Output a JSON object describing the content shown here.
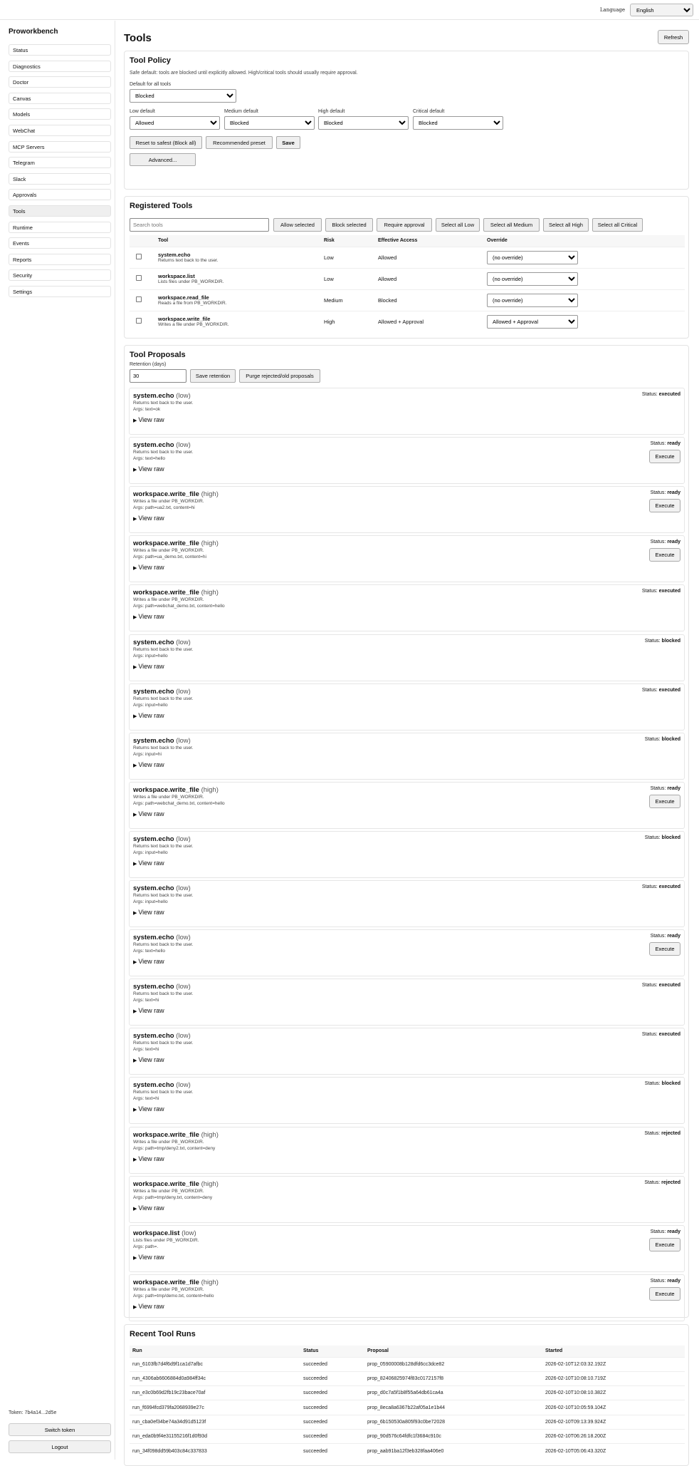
{
  "header": {
    "language_label": "Language",
    "language_value": "English"
  },
  "sidebar": {
    "brand": "Proworkbench",
    "items": [
      {
        "label": "Status"
      },
      {
        "label": "Diagnostics"
      },
      {
        "label": "Doctor"
      },
      {
        "label": "Canvas"
      },
      {
        "label": "Models"
      },
      {
        "label": "WebChat"
      },
      {
        "label": "MCP Servers"
      },
      {
        "label": "Telegram"
      },
      {
        "label": "Slack"
      },
      {
        "label": "Approvals"
      },
      {
        "label": "Tools",
        "active": true
      },
      {
        "label": "Runtime"
      },
      {
        "label": "Events"
      },
      {
        "label": "Reports"
      },
      {
        "label": "Security"
      },
      {
        "label": "Settings"
      }
    ],
    "token": "Token: 7b4a14...2d5e",
    "switch_token": "Switch token",
    "logout": "Logout"
  },
  "page": {
    "title": "Tools",
    "refresh": "Refresh"
  },
  "policy": {
    "title": "Tool Policy",
    "description": "Safe default: tools are blocked until explicitly allowed. High/critical tools should usually require approval.",
    "default_label": "Default for all tools",
    "default_value": "Blocked",
    "low_label": "Low default",
    "low_value": "Allowed",
    "medium_label": "Medium default",
    "medium_value": "Blocked",
    "high_label": "High default",
    "high_value": "Blocked",
    "critical_label": "Critical default",
    "critical_value": "Blocked",
    "reset_btn": "Reset to safest (Block all)",
    "recommended_btn": "Recommended preset",
    "save_btn": "Save",
    "advanced_btn": "Advanced..."
  },
  "registered": {
    "title": "Registered Tools",
    "search_placeholder": "Search tools",
    "buttons": {
      "allow": "Allow selected",
      "block": "Block selected",
      "approval": "Require approval",
      "low": "Select all Low",
      "medium": "Select all Medium",
      "high": "Select all High",
      "critical": "Select all Critical"
    },
    "columns": {
      "tool": "Tool",
      "risk": "Risk",
      "access": "Effective Access",
      "override": "Override"
    },
    "tools": [
      {
        "name": "system.echo",
        "desc": "Returns text back to the user.",
        "risk": "Low",
        "access": "Allowed",
        "override": "(no override)"
      },
      {
        "name": "workspace.list",
        "desc": "Lists files under PB_WORKDIR.",
        "risk": "Low",
        "access": "Allowed",
        "override": "(no override)"
      },
      {
        "name": "workspace.read_file",
        "desc": "Reads a file from PB_WORKDIR.",
        "risk": "Medium",
        "access": "Blocked",
        "override": "(no override)"
      },
      {
        "name": "workspace.write_file",
        "desc": "Writes a file under PB_WORKDIR.",
        "risk": "High",
        "access": "Allowed + Approval",
        "override": "Allowed + Approval"
      }
    ]
  },
  "proposals": {
    "title": "Tool Proposals",
    "retention_label": "Retention (days)",
    "retention_value": "30",
    "save_retention": "Save retention",
    "purge": "Purge rejected/old proposals",
    "status_prefix": "Status:",
    "view_raw": "View raw",
    "execute": "Execute",
    "items": [
      {
        "name": "system.echo",
        "risk": "(low)",
        "desc": "Returns text back to the user.",
        "args": "Args: text=ok",
        "status": "executed"
      },
      {
        "name": "system.echo",
        "risk": "(low)",
        "desc": "Returns text back to the user.",
        "args": "Args: text=hello",
        "status": "ready"
      },
      {
        "name": "workspace.write_file",
        "risk": "(high)",
        "desc": "Writes a file under PB_WORKDIR.",
        "args": "Args: path=ua2.txt, content=hi",
        "status": "ready"
      },
      {
        "name": "workspace.write_file",
        "risk": "(high)",
        "desc": "Writes a file under PB_WORKDIR.",
        "args": "Args: path=ua_demo.txt, content=hi",
        "status": "ready"
      },
      {
        "name": "workspace.write_file",
        "risk": "(high)",
        "desc": "Writes a file under PB_WORKDIR.",
        "args": "Args: path=webchat_demo.txt, content=hello",
        "status": "executed"
      },
      {
        "name": "system.echo",
        "risk": "(low)",
        "desc": "Returns text back to the user.",
        "args": "Args: input=hello",
        "status": "blocked"
      },
      {
        "name": "system.echo",
        "risk": "(low)",
        "desc": "Returns text back to the user.",
        "args": "Args: input=hello",
        "status": "executed"
      },
      {
        "name": "system.echo",
        "risk": "(low)",
        "desc": "Returns text back to the user.",
        "args": "Args: input=hi",
        "status": "blocked"
      },
      {
        "name": "workspace.write_file",
        "risk": "(high)",
        "desc": "Writes a file under PB_WORKDIR.",
        "args": "Args: path=webchat_demo.txt, content=hello",
        "status": "ready"
      },
      {
        "name": "system.echo",
        "risk": "(low)",
        "desc": "Returns text back to the user.",
        "args": "Args: input=hello",
        "status": "blocked"
      },
      {
        "name": "system.echo",
        "risk": "(low)",
        "desc": "Returns text back to the user.",
        "args": "Args: input=hello",
        "status": "executed"
      },
      {
        "name": "system.echo",
        "risk": "(low)",
        "desc": "Returns text back to the user.",
        "args": "Args: text=hello",
        "status": "ready"
      },
      {
        "name": "system.echo",
        "risk": "(low)",
        "desc": "Returns text back to the user.",
        "args": "Args: text=hi",
        "status": "executed"
      },
      {
        "name": "system.echo",
        "risk": "(low)",
        "desc": "Returns text back to the user.",
        "args": "Args: text=hi",
        "status": "executed"
      },
      {
        "name": "system.echo",
        "risk": "(low)",
        "desc": "Returns text back to the user.",
        "args": "Args: text=hi",
        "status": "blocked"
      },
      {
        "name": "workspace.write_file",
        "risk": "(high)",
        "desc": "Writes a file under PB_WORKDIR.",
        "args": "Args: path=tmp/deny2.txt, content=deny",
        "status": "rejected"
      },
      {
        "name": "workspace.write_file",
        "risk": "(high)",
        "desc": "Writes a file under PB_WORKDIR.",
        "args": "Args: path=tmp/deny.txt, content=deny",
        "status": "rejected"
      },
      {
        "name": "workspace.list",
        "risk": "(low)",
        "desc": "Lists files under PB_WORKDIR.",
        "args": "Args: path=.",
        "status": "ready"
      },
      {
        "name": "workspace.write_file",
        "risk": "(high)",
        "desc": "Writes a file under PB_WORKDIR.",
        "args": "Args: path=tmp/demo.txt, content=hello",
        "status": "ready"
      }
    ]
  },
  "runs": {
    "title": "Recent Tool Runs",
    "columns": {
      "run": "Run",
      "status": "Status",
      "proposal": "Proposal",
      "started": "Started"
    },
    "rows": [
      {
        "run": "run_6103fb7d4f6d9f1ca1d7afbc",
        "status": "succeeded",
        "proposal": "prop_05900008b128dfd6cc3dce82",
        "started": "2026-02-10T12:03:32.192Z"
      },
      {
        "run": "run_4306ab6606884d0a984ff34c",
        "status": "succeeded",
        "proposal": "prop_82406825974f83c0172157f8",
        "started": "2026-02-10T10:08:10.719Z"
      },
      {
        "run": "run_e3c0b69d2fb19c23bace70af",
        "status": "succeeded",
        "proposal": "prop_d0c7a5f1b8f55a64db61ca4a",
        "started": "2026-02-10T10:08:10.382Z"
      },
      {
        "run": "run_f6994fcd379fa2068939e27c",
        "status": "succeeded",
        "proposal": "prop_8eca8a6367b22af05a1e1b44",
        "started": "2026-02-10T10:05:59.104Z"
      },
      {
        "run": "run_cba0ef34be74a34d91d5123f",
        "status": "succeeded",
        "proposal": "prop_6b150530a805f93c0be72028",
        "started": "2026-02-10T09:13:39.924Z"
      },
      {
        "run": "run_eda0b9f4e31155216f1d0f93d",
        "status": "succeeded",
        "proposal": "prop_90d576c64fdfc1f3684c910c",
        "started": "2026-02-10T06:26:18.200Z"
      },
      {
        "run": "run_34f098dd59b403c84c337833",
        "status": "succeeded",
        "proposal": "prop_aab91ba12f3eb328faa406e0",
        "started": "2026-02-10T05:06:43.320Z"
      }
    ]
  }
}
